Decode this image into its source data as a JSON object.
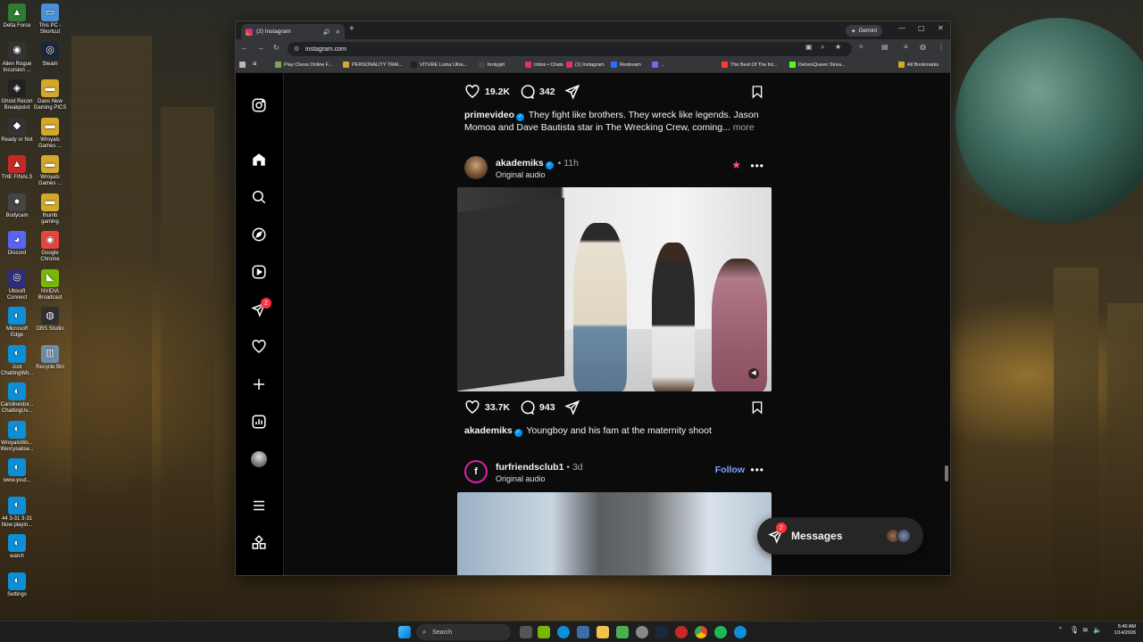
{
  "desktop": {
    "icons": [
      {
        "label": "Delta Force",
        "color": "#2e7d32",
        "glyph": "▲"
      },
      {
        "label": "This PC - Shortcut",
        "color": "#4a90d9",
        "glyph": "▭"
      },
      {
        "label": "Alien Rogue Incursion ...",
        "color": "#333",
        "glyph": "◉"
      },
      {
        "label": "Steam",
        "color": "#1b2838",
        "glyph": "◎"
      },
      {
        "label": "Ghost Recon Breakpoint",
        "color": "#222",
        "glyph": "◈"
      },
      {
        "label": "Dans New Gaming PICS",
        "color": "#d4a82a",
        "glyph": "▬"
      },
      {
        "label": "Ready or Not",
        "color": "#333",
        "glyph": "◆"
      },
      {
        "label": "Wroyals Games ...",
        "color": "#d4a82a",
        "glyph": "▬"
      },
      {
        "label": "THE FINALS",
        "color": "#c62828",
        "glyph": "▲"
      },
      {
        "label": "Wroyals Games ...",
        "color": "#d4a82a",
        "glyph": "▬"
      },
      {
        "label": "Bodycam",
        "color": "#444",
        "glyph": "●"
      },
      {
        "label": "thumb gaming",
        "color": "#d4a82a",
        "glyph": "▬"
      },
      {
        "label": "Discord",
        "color": "#5865f2",
        "glyph": "◕"
      },
      {
        "label": "Google Chrome",
        "color": "#e8453c",
        "glyph": "◉"
      },
      {
        "label": "Ubisoft Connect",
        "color": "#2d2d7a",
        "glyph": "◎"
      },
      {
        "label": "NVIDIA Broadcast",
        "color": "#76b900",
        "glyph": "◣"
      },
      {
        "label": "Microsoft Edge",
        "color": "#0c8fd6",
        "glyph": "◐"
      },
      {
        "label": "OBS Studio",
        "color": "#302e31",
        "glyph": "◍"
      },
      {
        "label": "Just ChattingWit...",
        "color": "#0c8fd6",
        "glyph": "◐"
      },
      {
        "label": "Recycle Bin",
        "color": "#6c8ea8",
        "glyph": "▥"
      },
      {
        "label": "Carolinestor... ChattingUv...",
        "color": "#0c8fd6",
        "glyph": "◐"
      },
      {
        "label": "WroyalsWo... Wercysalow...",
        "color": "#0c8fd6",
        "glyph": "◐"
      },
      {
        "label": "www.yout...",
        "color": "#0c8fd6",
        "glyph": "◐"
      },
      {
        "label": "44 3-31 3-31 Now playin...",
        "color": "#0c8fd6",
        "glyph": "◐"
      },
      {
        "label": "watch",
        "color": "#0c8fd6",
        "glyph": "◐"
      },
      {
        "label": "Settings",
        "color": "#0c8fd6",
        "glyph": "◐"
      }
    ]
  },
  "browser": {
    "tab_title": "(2) Instagram",
    "gemini_label": "Gemini",
    "url": "instagram.com",
    "bookmarks": [
      {
        "label": "Play Chess Online F...",
        "color": "#7fa650"
      },
      {
        "label": "PERSONALITY TRAI...",
        "color": "#d4a82a"
      },
      {
        "label": "VITURE Luma Ultra...",
        "color": "#222"
      },
      {
        "label": "fentygirl",
        "color": "#444"
      },
      {
        "label": "Inbox • Chats",
        "color": "#e1306c"
      },
      {
        "label": "(1) Instagram",
        "color": "#e1306c"
      },
      {
        "label": "Restream",
        "color": "#2b6fff"
      },
      {
        "label": "...",
        "color": "#8a5cf6"
      },
      {
        "label": "The Best Of The Int...",
        "color": "#ff3b30"
      },
      {
        "label": "DelvesQueen Strea...",
        "color": "#53fc18"
      },
      {
        "label": "All Bookmarks",
        "color": "#d4a82a"
      }
    ]
  },
  "instagram": {
    "post1": {
      "likes": "19.2K",
      "comments": "342",
      "caption_user": "primevideo",
      "caption_text": "They fight like brothers. They wreck like legends. Jason Momoa and Dave Bautista star in The Wrecking Crew, coming...",
      "more_label": "more"
    },
    "post2": {
      "username": "akademiks",
      "time": "• 11h",
      "audio": "Original audio",
      "likes": "33.7K",
      "comments": "943",
      "caption_user": "akademiks",
      "caption_text": "Youngboy and his fam at the maternity shoot"
    },
    "post3": {
      "username": "furfriendsclub1",
      "time": "• 3d",
      "audio": "Original audio",
      "follow_label": "Follow"
    },
    "notifications_badge": "2",
    "messages": {
      "label": "Messages",
      "badge": "2"
    }
  },
  "taskbar": {
    "search_placeholder": "Search",
    "time": "5:40 AM",
    "date": "1/14/2026"
  }
}
